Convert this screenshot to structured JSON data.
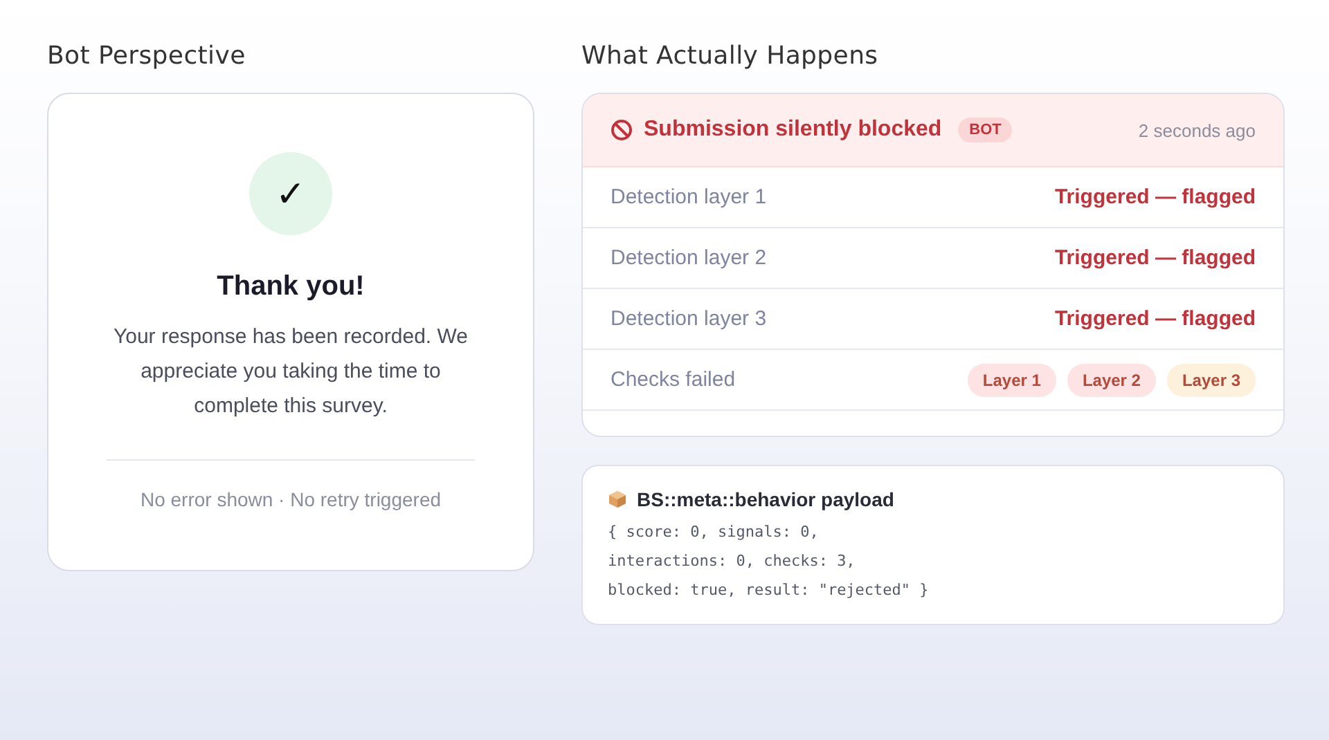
{
  "left": {
    "title": "Bot Perspective",
    "card": {
      "check": "✓",
      "heading": "Thank you!",
      "message": "Your response has been recorded. We appreciate you taking the time to complete this survey.",
      "footer": "No error shown · No retry triggered"
    }
  },
  "right": {
    "title": "What Actually Happens",
    "alert": {
      "title": "Submission silently blocked",
      "badge": "BOT",
      "time": "2 seconds ago"
    },
    "rows": [
      {
        "kind": "status",
        "label": "Detection layer 1",
        "value": "Triggered — flagged"
      },
      {
        "kind": "status",
        "label": "Detection layer 2",
        "value": "Triggered — flagged"
      },
      {
        "kind": "status",
        "label": "Detection layer 3",
        "value": "Triggered — flagged"
      },
      {
        "kind": "chips",
        "label": "Checks failed",
        "chips": [
          {
            "label": "Layer 1",
            "color": "#fde3e3"
          },
          {
            "label": "Layer 2",
            "color": "#fde3e3"
          },
          {
            "label": "Layer 3",
            "color": "#fdf1dc"
          }
        ]
      }
    ],
    "payload": {
      "title": "BS::meta::behavior payload",
      "lines": [
        "{ score: 0, signals: 0,",
        "interactions: 0, checks: 3,",
        "blocked: true, result: \"rejected\" }"
      ]
    }
  }
}
